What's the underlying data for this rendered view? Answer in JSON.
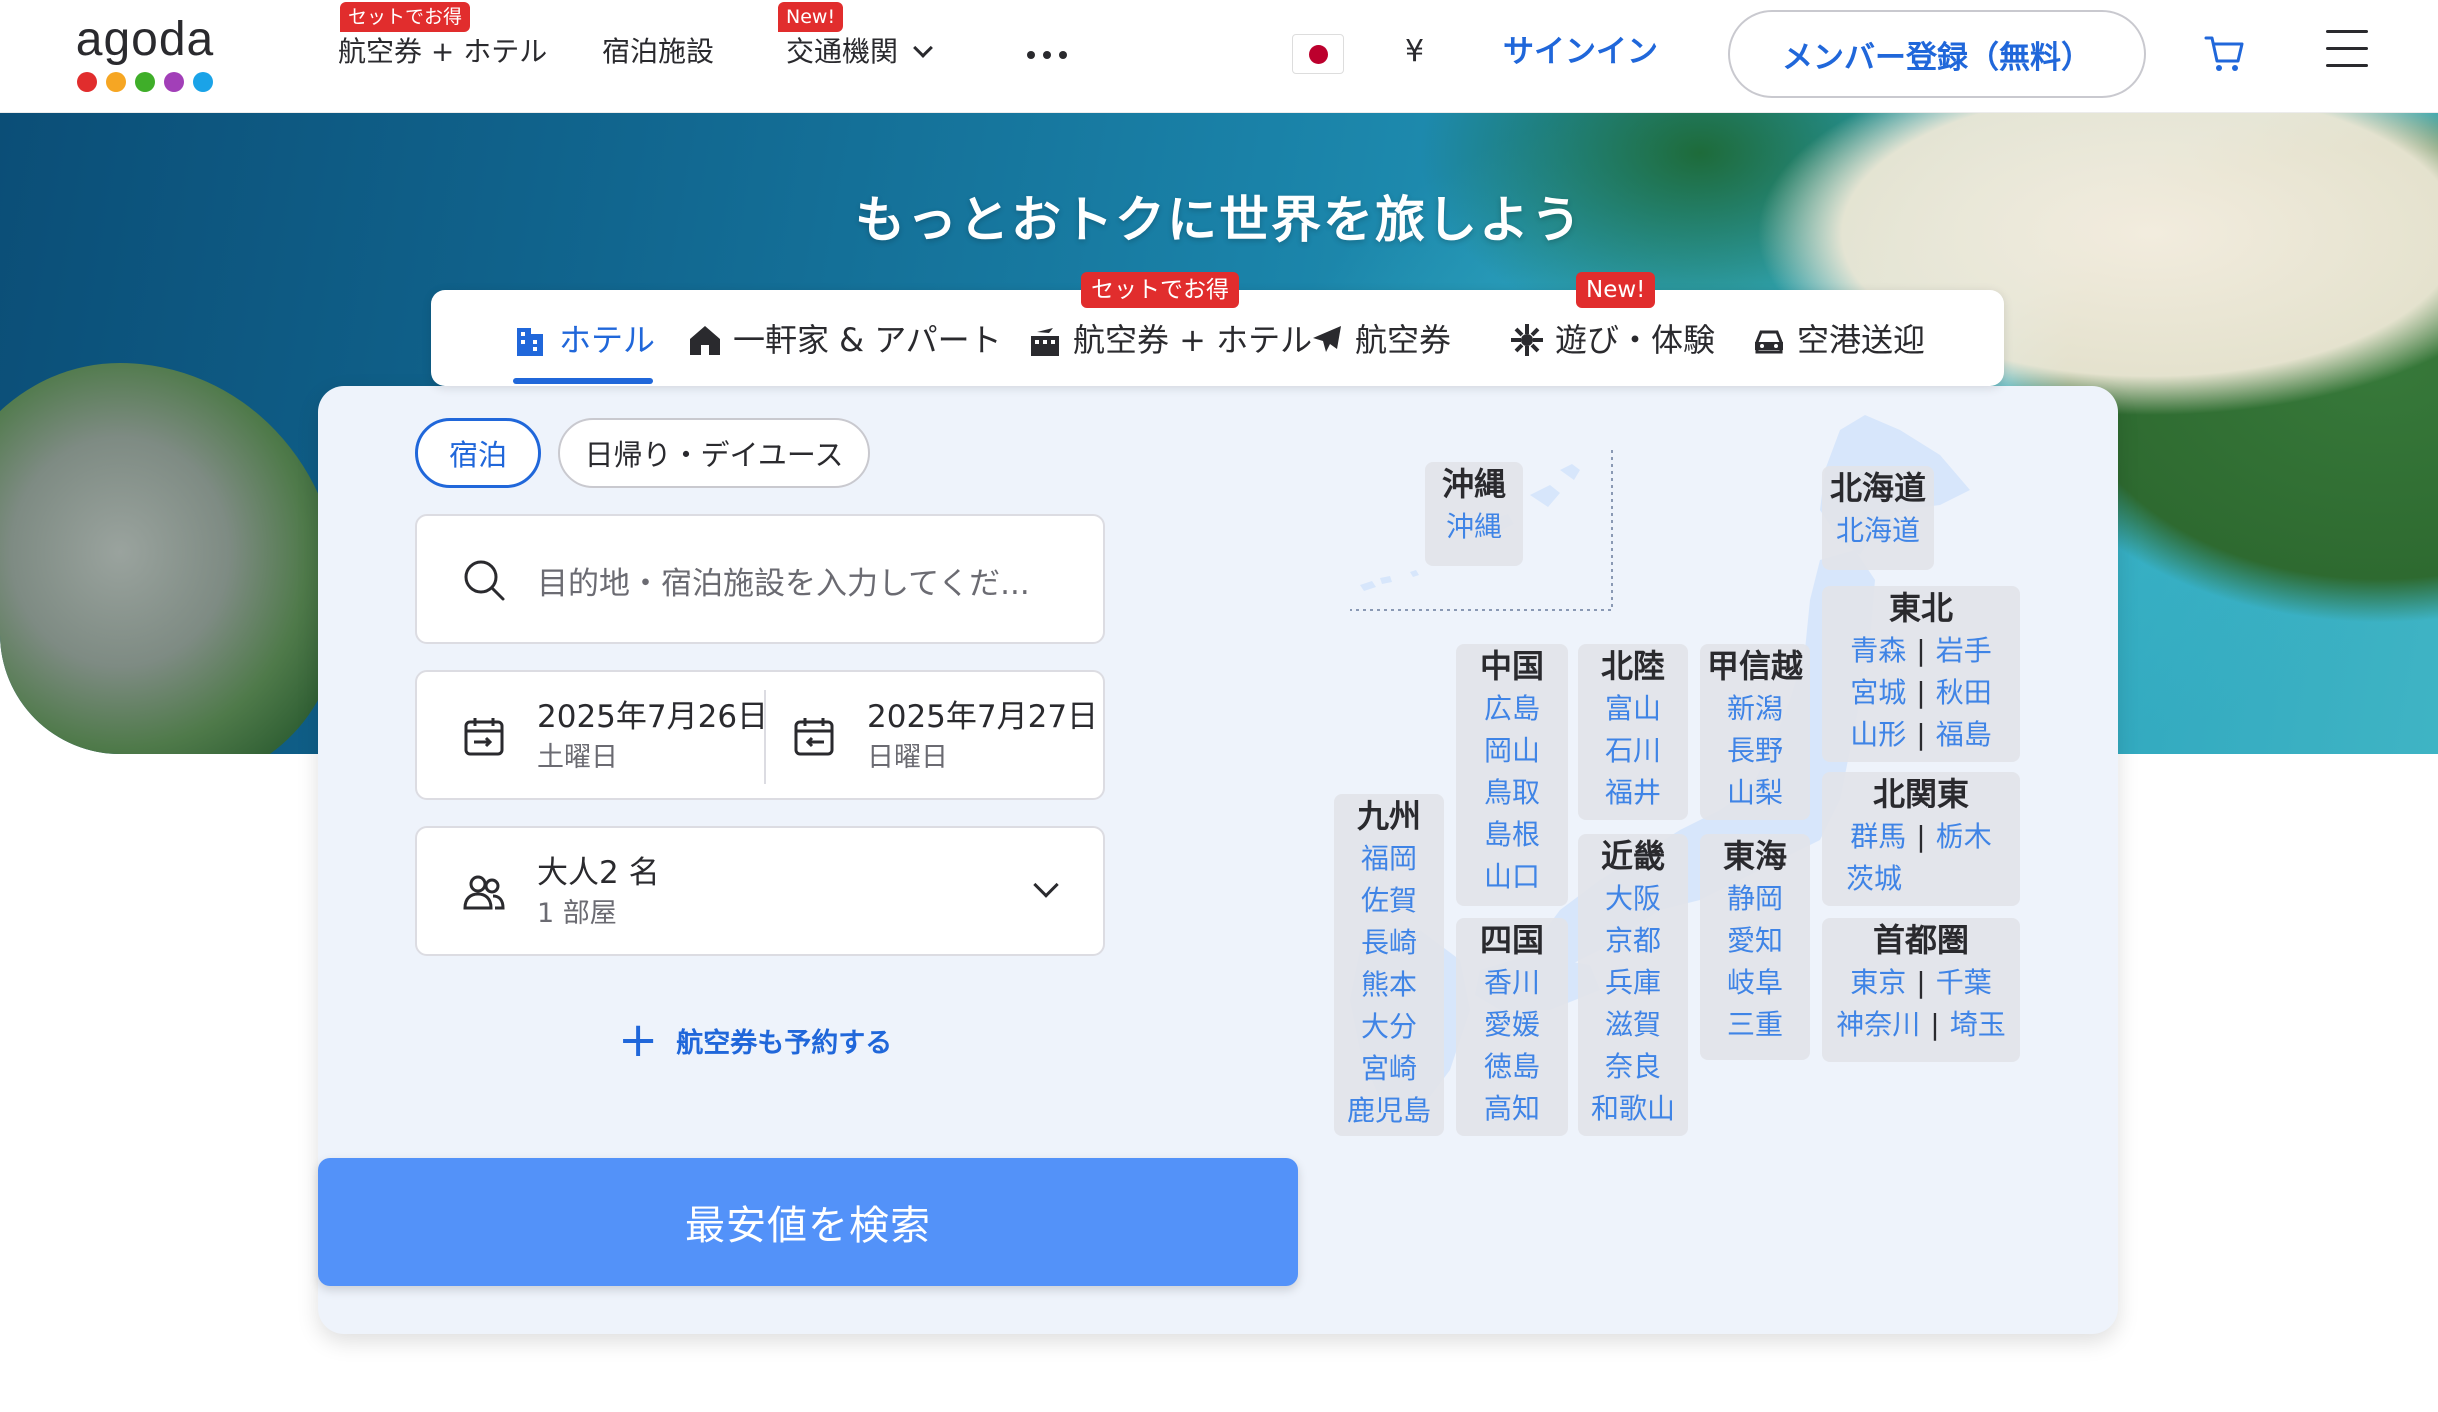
{
  "header": {
    "logo": "agoda",
    "logo_colors": [
      "#e12d2d",
      "#f6a623",
      "#3fae29",
      "#a23fb8",
      "#1aa3e8"
    ],
    "nav": [
      {
        "label": "航空券 + ホテル",
        "badge": "セットでお得"
      },
      {
        "label": "宿泊施設",
        "badge": ""
      },
      {
        "label": "交通機関",
        "badge": "New!"
      }
    ],
    "currency": "¥",
    "signin": "サインイン",
    "register": "メンバー登録（無料）"
  },
  "hero": {
    "title": "もっとおトクに世界を旅しよう"
  },
  "tabs": [
    {
      "label": "ホテル",
      "icon": "hotel-icon",
      "active": true,
      "badge": ""
    },
    {
      "label": "一軒家 & アパート",
      "icon": "home-icon",
      "active": false,
      "badge": ""
    },
    {
      "label": "航空券 + ホテル",
      "icon": "flight-hotel-icon",
      "active": false,
      "badge": "セットでお得"
    },
    {
      "label": "航空券",
      "icon": "airplane-icon",
      "active": false,
      "badge": ""
    },
    {
      "label": "遊び・体験",
      "icon": "activities-icon",
      "active": false,
      "badge": "New!"
    },
    {
      "label": "空港送迎",
      "icon": "car-icon",
      "active": false,
      "badge": ""
    }
  ],
  "search": {
    "stay_type": "宿泊",
    "day_use": "日帰り・デイユース",
    "placeholder": "目的地・宿泊施設を入力してくだ...",
    "checkin": {
      "date": "2025年7月26日",
      "day": "土曜日"
    },
    "checkout": {
      "date": "2025年7月27日",
      "day": "日曜日"
    },
    "guests": "大人2 名",
    "rooms": "1 部屋",
    "add_flight": "航空券も予約する",
    "submit": "最安値を検索"
  },
  "map": {
    "okinawa": {
      "name": "沖縄",
      "prefs": [
        "沖縄"
      ]
    },
    "hokkaido": {
      "name": "北海道",
      "prefs": [
        "北海道"
      ]
    },
    "tohoku": {
      "name": "東北",
      "rows": [
        [
          "青森",
          "岩手"
        ],
        [
          "宮城",
          "秋田"
        ],
        [
          "山形",
          "福島"
        ]
      ]
    },
    "chugoku": {
      "name": "中国",
      "prefs": [
        "広島",
        "岡山",
        "鳥取",
        "島根",
        "山口"
      ]
    },
    "hokuriku": {
      "name": "北陸",
      "prefs": [
        "富山",
        "石川",
        "福井"
      ]
    },
    "koshinetsu": {
      "name": "甲信越",
      "prefs": [
        "新潟",
        "長野",
        "山梨"
      ]
    },
    "kitakanto": {
      "name": "北関東",
      "rows": [
        [
          "群馬",
          "栃木"
        ],
        [
          "茨城"
        ]
      ]
    },
    "kyushu": {
      "name": "九州",
      "prefs": [
        "福岡",
        "佐賀",
        "長崎",
        "熊本",
        "大分",
        "宮崎",
        "鹿児島"
      ]
    },
    "shikoku": {
      "name": "四国",
      "prefs": [
        "香川",
        "愛媛",
        "徳島",
        "高知"
      ]
    },
    "kinki": {
      "name": "近畿",
      "prefs": [
        "大阪",
        "京都",
        "兵庫",
        "滋賀",
        "奈良",
        "和歌山"
      ]
    },
    "tokai": {
      "name": "東海",
      "prefs": [
        "静岡",
        "愛知",
        "岐阜",
        "三重"
      ]
    },
    "shutoken": {
      "name": "首都圏",
      "rows": [
        [
          "東京",
          "千葉"
        ],
        [
          "神奈川",
          "埼玉"
        ]
      ]
    }
  }
}
